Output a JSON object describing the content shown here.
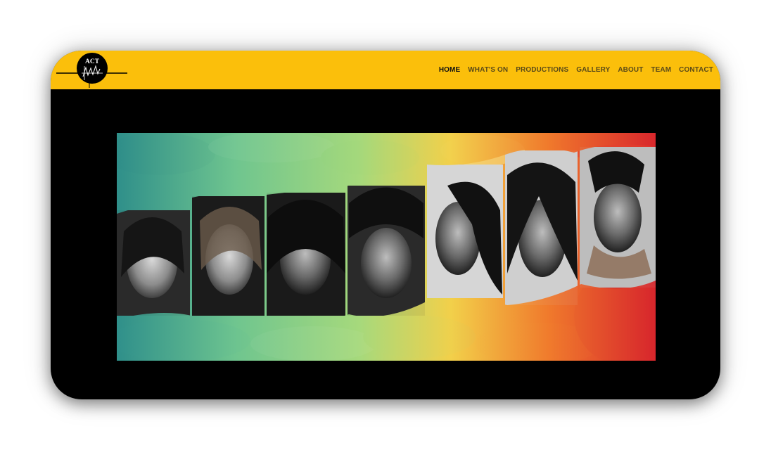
{
  "logo": {
    "text": "ACT",
    "icon": "act-logo-icon",
    "colors": {
      "circle": "#000000",
      "text": "#ffffff"
    }
  },
  "header": {
    "background": "#fbbf0b",
    "nav": [
      {
        "label": "HOME",
        "active": true
      },
      {
        "label": "WHAT'S ON",
        "active": false
      },
      {
        "label": "PRODUCTIONS",
        "active": false
      },
      {
        "label": "GALLERY",
        "active": false
      },
      {
        "label": "ABOUT",
        "active": false
      },
      {
        "label": "TEAM",
        "active": false
      },
      {
        "label": "CONTACT",
        "active": false
      }
    ]
  },
  "hero": {
    "image": "cast-portraits-banner",
    "portraits": 7,
    "colors": [
      "#2f8f8a",
      "#8fd17a",
      "#f2d04a",
      "#f07a2c",
      "#d8262c"
    ]
  }
}
